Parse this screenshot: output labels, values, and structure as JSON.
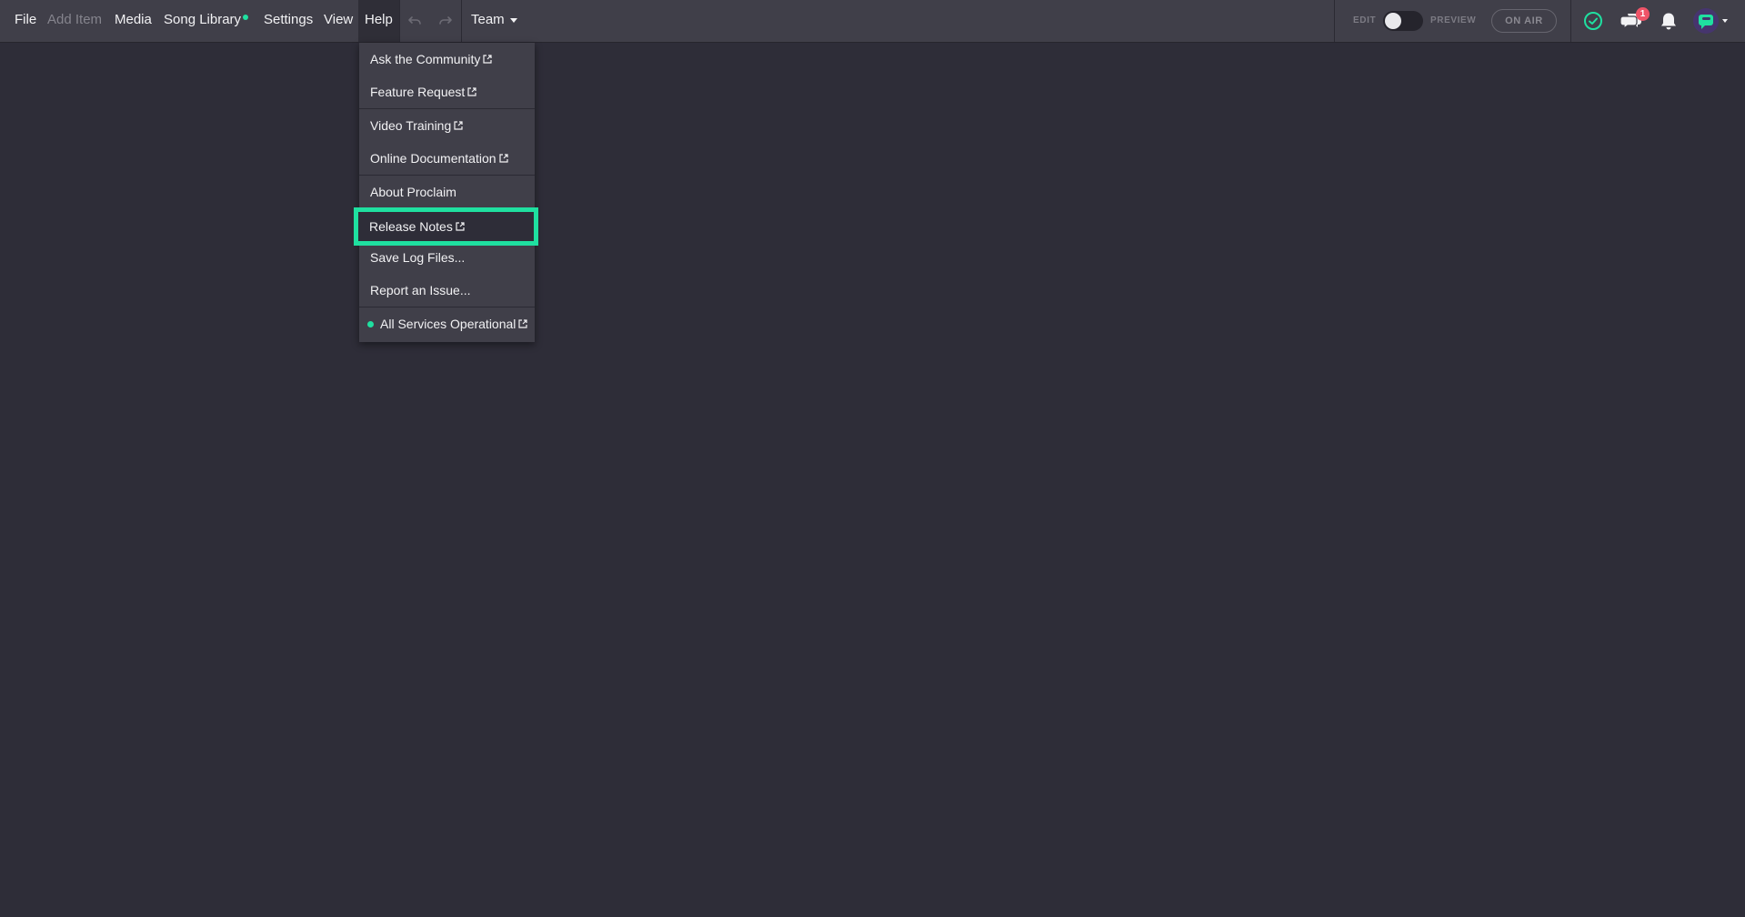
{
  "menubar": {
    "file": "File",
    "add_item": "Add Item",
    "media": "Media",
    "song_library": "Song Library",
    "settings": "Settings",
    "view": "View",
    "help": "Help",
    "team": "Team",
    "undo_icon": "undo-icon",
    "redo_icon": "redo-icon"
  },
  "mode": {
    "edit_label": "EDIT",
    "preview_label": "PREVIEW",
    "on_air_label": "ON AIR"
  },
  "status_icons": {
    "check_icon": "check-circle-icon",
    "chat_icon": "chat-icon",
    "chat_badge": "1",
    "bell_icon": "bell-icon",
    "avatar_icon": "app-logo-avatar"
  },
  "help_menu": {
    "items": [
      {
        "label": "Ask the Community",
        "external": true
      },
      {
        "label": "Feature Request",
        "external": true
      },
      {
        "label": "Video Training",
        "external": true
      },
      {
        "label": "Online Documentation",
        "external": true
      },
      {
        "label": "About Proclaim",
        "external": false
      },
      {
        "label": "Release Notes",
        "external": true
      },
      {
        "label": "Save Log Files...",
        "external": false
      },
      {
        "label": "Report an Issue...",
        "external": false
      },
      {
        "label": "All Services Operational",
        "external": true
      }
    ]
  },
  "colors": {
    "accent": "#1fe0a0",
    "menubar_bg": "#403f49",
    "page_bg": "#2e2d38",
    "badge": "#ef5468"
  }
}
